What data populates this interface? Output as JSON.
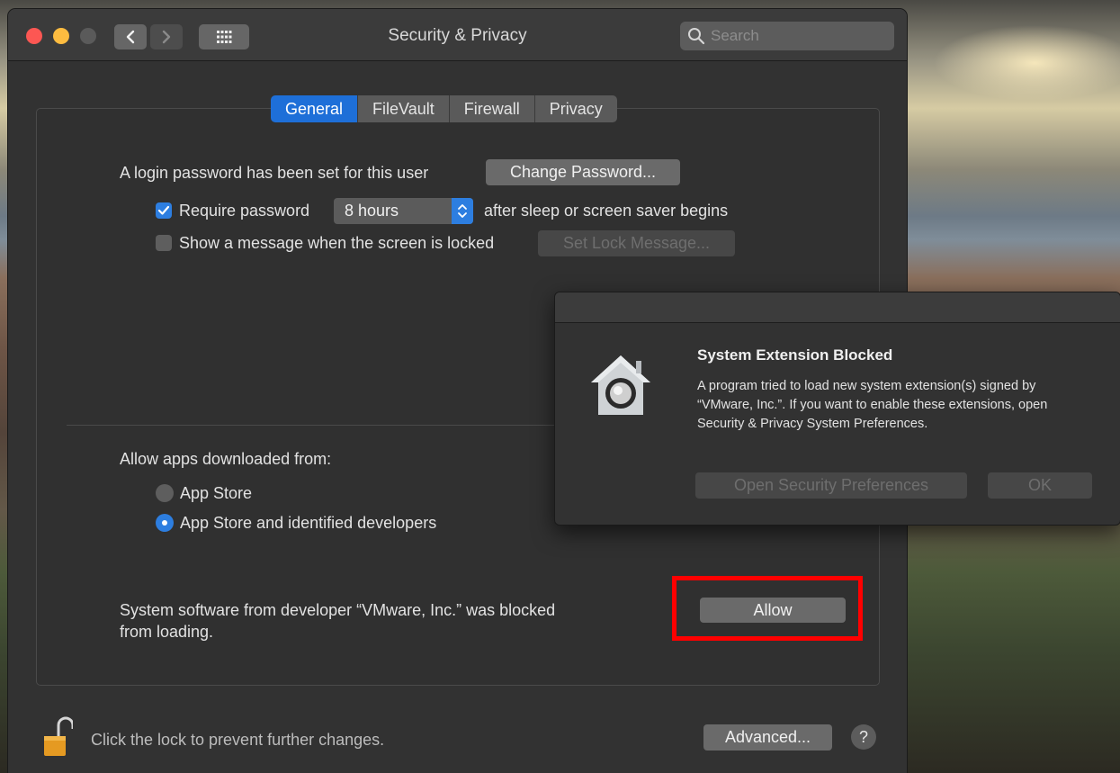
{
  "window": {
    "title": "Security & Privacy"
  },
  "search": {
    "placeholder": "Search",
    "icon": "search-icon"
  },
  "tabs": [
    {
      "label": "General",
      "active": true
    },
    {
      "label": "FileVault",
      "active": false
    },
    {
      "label": "Firewall",
      "active": false
    },
    {
      "label": "Privacy",
      "active": false
    }
  ],
  "general": {
    "login_text": "A login password has been set for this user",
    "change_password_label": "Change Password...",
    "require_password": {
      "label": "Require password",
      "checked": true
    },
    "require_interval": "8 hours",
    "after_text": "after sleep or screen saver begins",
    "show_message": {
      "label": "Show a message when the screen is locked",
      "checked": false
    },
    "set_lock_message_label": "Set Lock Message...",
    "allow_apps_label": "Allow apps downloaded from:",
    "radio_options": [
      {
        "label": "App Store",
        "selected": false
      },
      {
        "label": "App Store and identified developers",
        "selected": true
      }
    ],
    "blocked_text_line1": "System software from developer “VMware, Inc.” was blocked",
    "blocked_text_line2": "from loading.",
    "allow_label": "Allow"
  },
  "footer": {
    "lock_text": "Click the lock to prevent further changes.",
    "advanced_label": "Advanced...",
    "help_label": "?"
  },
  "dialog": {
    "title": "System Extension Blocked",
    "body": "A program tried to load new system extension(s) signed by “VMware, Inc.”.  If you want to enable these extensions, open Security & Privacy System Preferences.",
    "open_prefs_label": "Open Security Preferences",
    "ok_label": "OK"
  },
  "colors": {
    "accent": "#1e6fd8",
    "highlight": "#ff0000"
  }
}
